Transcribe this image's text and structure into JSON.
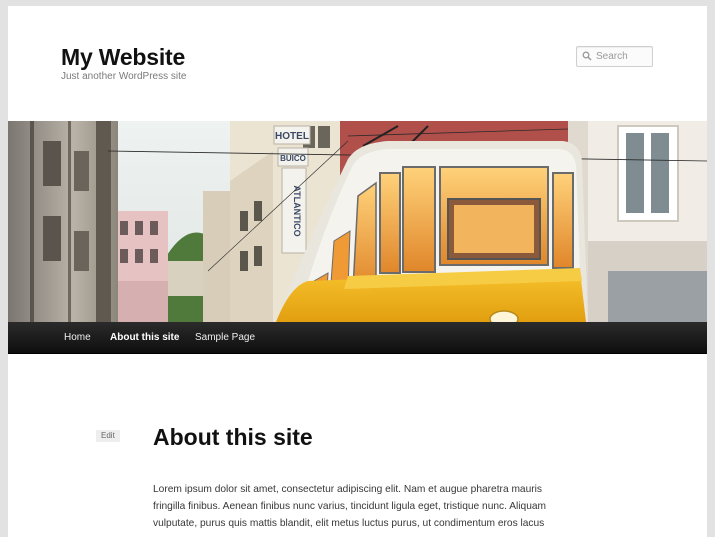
{
  "header": {
    "site_title": "My Website",
    "site_description": "Just another WordPress site"
  },
  "search": {
    "placeholder": "Search"
  },
  "header_image": {
    "signs": [
      "HOTEL",
      "BUICO",
      "ATLANTICO"
    ],
    "tram_color": "#f2b41c"
  },
  "nav": {
    "items": [
      {
        "label": "Home"
      },
      {
        "label": "About this site"
      },
      {
        "label": "Sample Page"
      }
    ],
    "current": "About this site"
  },
  "page": {
    "edit_label": "Edit",
    "title": "About this site",
    "content": "Lorem ipsum dolor sit amet, consectetur adipiscing elit. Nam et augue pharetra mauris fringilla finibus. Aenean finibus nunc varius, tincidunt ligula eget, tristique nunc. Aliquam vulputate, purus quis mattis blandit, elit metus luctus purus, ut condimentum eros lacus"
  },
  "colors": {
    "nav_background": "#1a1a1a",
    "accent": "#f2b41c",
    "page_background": "#ffffff"
  }
}
